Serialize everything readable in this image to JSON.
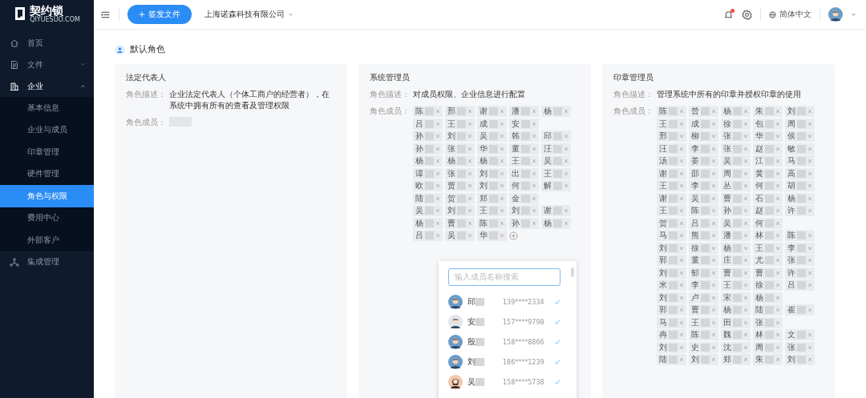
{
  "logo": {
    "name": "契约锁",
    "domain": "QIYUESUO.COM"
  },
  "sidebar": {
    "items": [
      {
        "label": "首页",
        "selected": false
      },
      {
        "label": "文件",
        "selected": false,
        "expanded": false
      },
      {
        "label": "企业",
        "selected": false,
        "expanded": true,
        "children": [
          {
            "label": "基本信息",
            "selected": false
          },
          {
            "label": "企业与成员",
            "selected": false
          },
          {
            "label": "印章管理",
            "selected": false
          },
          {
            "label": "硬件管理",
            "selected": false
          },
          {
            "label": "角色与权限",
            "selected": true
          },
          {
            "label": "费用中心",
            "selected": false
          },
          {
            "label": "外部客户",
            "selected": false
          }
        ]
      },
      {
        "label": "集成管理",
        "selected": false
      }
    ]
  },
  "topbar": {
    "primary_button": "签发文件",
    "company": "上海诺森科技有限公司",
    "notification_unread": true,
    "language": "简体中文"
  },
  "section": {
    "title": "默认角色"
  },
  "roles": [
    {
      "title": "法定代表人",
      "description_label": "角色描述：",
      "description": "企业法定代表人（个体工商户的经营者），在系统中拥有所有的查看及管理权限",
      "members_label": "角色成员：",
      "redacted_member": true
    },
    {
      "title": "系统管理员",
      "description_label": "角色描述：",
      "description": "对成员权限、企业信息进行配置",
      "members_label": "角色成员：",
      "member_rows": [
        [
          "陈",
          "邢",
          "谢",
          "潘",
          "杨"
        ],
        [
          "吕",
          "王",
          "成",
          "安"
        ],
        [
          "孙",
          "刘",
          "吴",
          "韩",
          "邱"
        ],
        [
          "孙",
          "张",
          "华",
          "董",
          "汪"
        ],
        [
          "杨",
          "杨",
          "杨",
          "王",
          "吴"
        ],
        [
          "谭",
          "张",
          "刘",
          "出",
          "王"
        ],
        [
          "欧",
          "贾",
          "刘",
          "何",
          "解"
        ],
        [
          "陆",
          "贺",
          "郑",
          "金"
        ],
        [
          "吴",
          "刘",
          "王",
          "刘",
          "谢"
        ],
        [
          "杨",
          "曹",
          "陈",
          "孙",
          "杨"
        ],
        [
          "吕",
          "吴",
          "华"
        ]
      ],
      "picker": {
        "placeholder": "输入成员名称搜索",
        "options": [
          {
            "name": "邱",
            "phone": "139****2334",
            "checked": true,
            "kind": "man"
          },
          {
            "name": "安",
            "phone": "157****9798",
            "checked": true,
            "kind": "man-light"
          },
          {
            "name": "殷",
            "phone": "158****8866",
            "checked": true,
            "kind": "man"
          },
          {
            "name": "刘",
            "phone": "186****1239",
            "checked": true,
            "kind": "man"
          },
          {
            "name": "吴",
            "phone": "158****5738",
            "checked": true,
            "kind": "woman"
          }
        ]
      }
    },
    {
      "title": "印章管理员",
      "description_label": "角色描述：",
      "description": "管理系统中所有的印章并授权印章的使用",
      "members_label": "角色成员：",
      "member_rows": [
        [
          "陈",
          "曾",
          "杨",
          "朱",
          "刘"
        ],
        [
          "王",
          "成",
          "徐",
          "包",
          "周"
        ],
        [
          "邢",
          "柳",
          "张",
          "华",
          "侯"
        ],
        [
          "汪",
          "李",
          "张",
          "赵",
          "敏"
        ],
        [
          "汤",
          "姜",
          "吴",
          "江",
          "马"
        ],
        [
          "谢",
          "邵",
          "周",
          "黄",
          "高"
        ],
        [
          "王",
          "李",
          "丛",
          "何",
          "胡"
        ],
        [
          "谢",
          "吴",
          "曹",
          "石",
          "杨"
        ],
        [
          "王",
          "陈",
          "孙",
          "赵",
          "许"
        ],
        [
          "贺",
          "吕",
          "吴",
          "何"
        ],
        [
          "马",
          "熊",
          "潘",
          "林",
          "陈"
        ],
        [
          "刘",
          "徐",
          "杨",
          "王",
          "李"
        ],
        [
          "郭",
          "董",
          "庄",
          "尤",
          "张"
        ],
        [
          "刘",
          "郁",
          "曹",
          "曹",
          "许"
        ],
        [
          "米",
          "李",
          "王",
          "徐",
          "吕"
        ],
        [
          "刘",
          "卢",
          "宋",
          "杨"
        ],
        [
          "郭",
          "曹",
          "杨",
          "陆",
          "崔"
        ],
        [
          "马",
          "王",
          "田",
          "张"
        ],
        [
          "冉",
          "陈",
          "魏",
          "林",
          "文"
        ],
        [
          "刘",
          "史",
          "沈",
          "周",
          "张"
        ],
        [
          "陆",
          "刘",
          "郑",
          "朱",
          "刘"
        ]
      ]
    }
  ]
}
